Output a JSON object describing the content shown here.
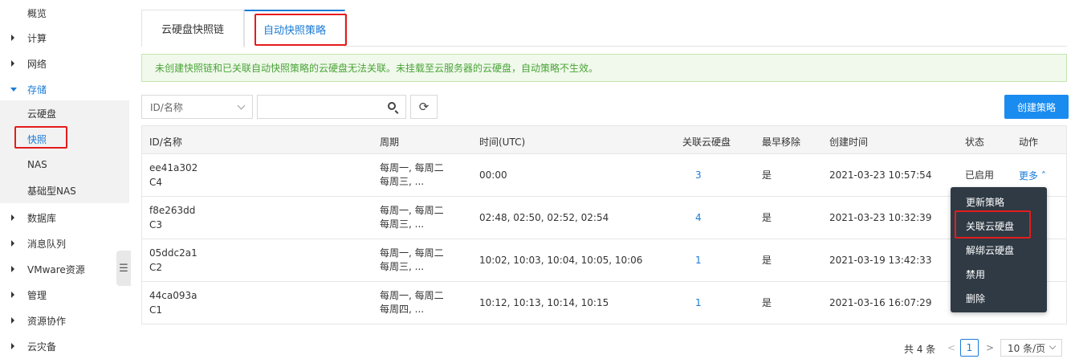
{
  "sidebar": {
    "items": [
      {
        "label": "概览"
      },
      {
        "label": "计算"
      },
      {
        "label": "网络"
      },
      {
        "label": "存储"
      },
      {
        "label": "数据库"
      },
      {
        "label": "消息队列"
      },
      {
        "label": "VMware资源"
      },
      {
        "label": "管理"
      },
      {
        "label": "资源协作"
      },
      {
        "label": "云灾备"
      }
    ],
    "storage_sub": [
      {
        "label": "云硬盘"
      },
      {
        "label": "快照"
      },
      {
        "label": "NAS"
      },
      {
        "label": "基础型NAS"
      }
    ],
    "collapse_icon": "☰"
  },
  "tabs": [
    {
      "label": "云硬盘快照链"
    },
    {
      "label": "自动快照策略"
    }
  ],
  "alert": "未创建快照链和已关联自动快照策略的云硬盘无法关联。未挂载至云服务器的云硬盘，自动策略不生效。",
  "toolbar": {
    "select_value": "ID/名称",
    "search_placeholder": "",
    "refresh_icon": "⟳",
    "create_label": "创建策略"
  },
  "table": {
    "headers": {
      "id": "ID/名称",
      "cycle": "周期",
      "time": "时间(UTC)",
      "disks": "关联云硬盘",
      "earliest": "最早移除",
      "created": "创建时间",
      "status": "状态",
      "action": "动作"
    },
    "rows": [
      {
        "id": "ee41a302",
        "name": "C4",
        "cycle1": "每周一, 每周二",
        "cycle2": "每周三, ...",
        "time": "00:00",
        "disks": "3",
        "earliest": "是",
        "created": "2021-03-23 10:57:54",
        "status": "已启用",
        "more": "更多"
      },
      {
        "id": "f8e263dd",
        "name": "C3",
        "cycle1": "每周一, 每周二",
        "cycle2": "每周三, ...",
        "time": "02:48, 02:50, 02:52, 02:54",
        "disks": "4",
        "earliest": "是",
        "created": "2021-03-23 10:32:39",
        "status": "",
        "more": ""
      },
      {
        "id": "05ddc2a1",
        "name": "C2",
        "cycle1": "每周一, 每周二",
        "cycle2": "每周三, ...",
        "time": "10:02, 10:03, 10:04, 10:05, 10:06",
        "disks": "1",
        "earliest": "是",
        "created": "2021-03-19 13:42:33",
        "status": "",
        "more": ""
      },
      {
        "id": "44ca093a",
        "name": "C1",
        "cycle1": "每周一, 每周二",
        "cycle2": "每周四, ...",
        "time": "10:12, 10:13, 10:14, 10:15",
        "disks": "1",
        "earliest": "是",
        "created": "2021-03-16 16:07:29",
        "status": "",
        "more": ""
      }
    ]
  },
  "menu": [
    {
      "label": "更新策略"
    },
    {
      "label": "关联云硬盘"
    },
    {
      "label": "解绑云硬盘"
    },
    {
      "label": "禁用"
    },
    {
      "label": "删除"
    }
  ],
  "pager": {
    "total": "共 4 条",
    "prev": "<",
    "page": "1",
    "next": ">",
    "size": "10 条/页"
  },
  "colors": {
    "accent": "#1a7bd6",
    "highlight": "#e41c1c",
    "alert_text": "#4aa338"
  }
}
